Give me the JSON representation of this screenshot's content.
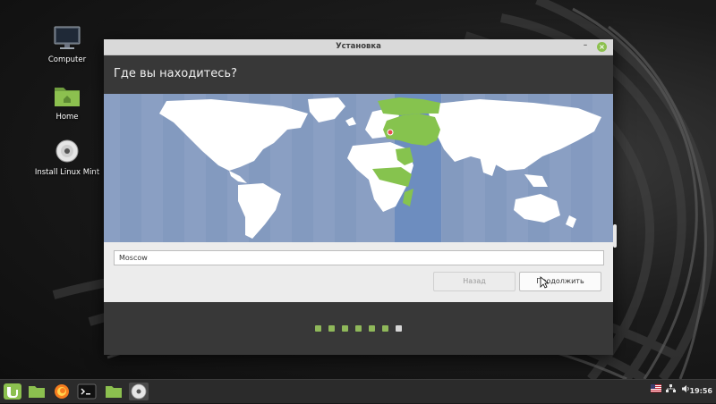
{
  "desktop": {
    "icons": [
      {
        "label": "Computer",
        "icon": "computer-icon"
      },
      {
        "label": "Home",
        "icon": "home-folder-icon"
      },
      {
        "label": "Install Linux Mint",
        "icon": "install-disc-icon"
      }
    ]
  },
  "window": {
    "title": "Установка",
    "heading": "Где вы находитесь?",
    "city_value": "Moscow",
    "back_label": "Назад",
    "next_label": "Продолжить",
    "progress": {
      "total_steps": 7,
      "current_step": 7
    }
  },
  "panel": {
    "items": [
      "mint-menu-icon",
      "show-desktop-icon",
      "firefox-icon",
      "terminal-icon",
      "files-icon",
      "install-disc-icon"
    ],
    "tray": [
      "us-flag-icon",
      "network-icon",
      "volume-icon"
    ],
    "clock": "19:56"
  },
  "colors": {
    "accent": "#8cc04f",
    "ocean": "#8a9fc3",
    "timezone_band": "#6d8dbf",
    "selected_region": "#86c34e",
    "header_bg": "#383838"
  }
}
